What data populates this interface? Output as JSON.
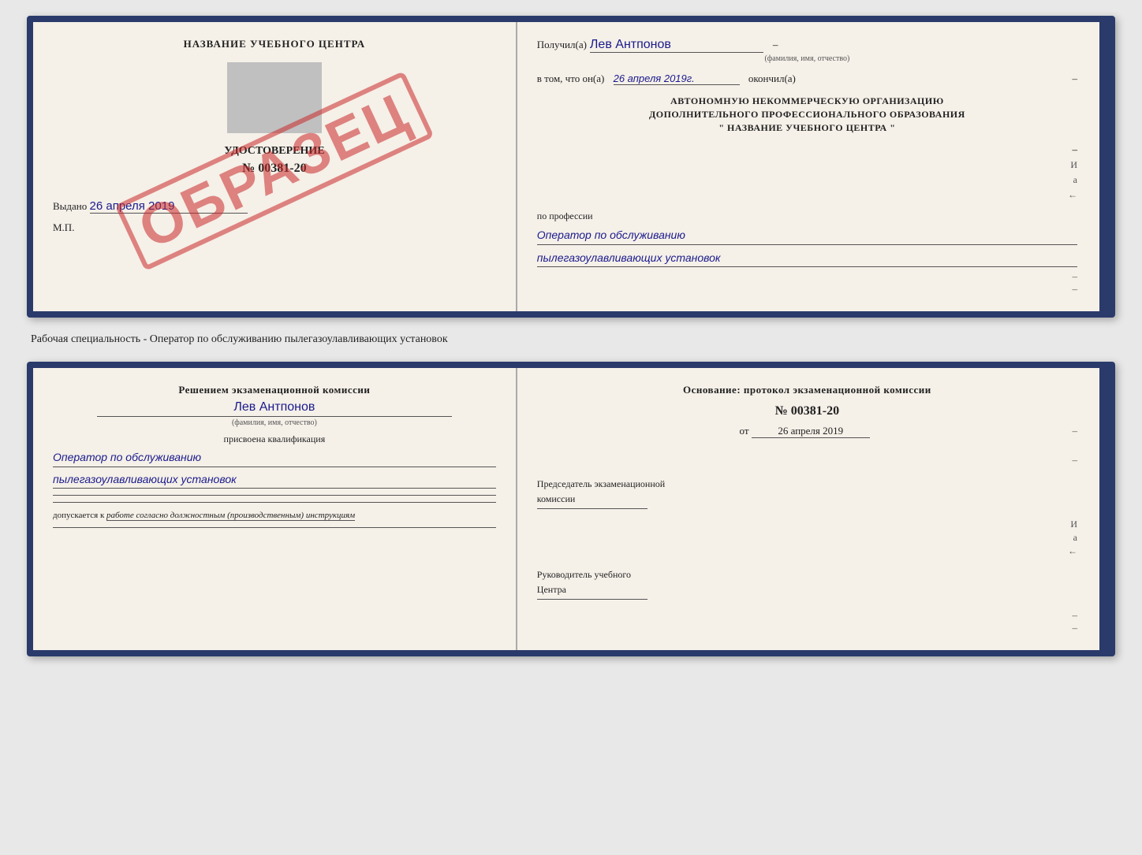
{
  "page": {
    "background": "#e8e8e8"
  },
  "topDoc": {
    "left": {
      "schoolNameLabel": "НАЗВАНИЕ УЧЕБНОГО ЦЕНТРА",
      "certTitle": "УДОСТОВЕРЕНИЕ",
      "certNumber": "№ 00381-20",
      "issuedText": "Выдано",
      "issuedDate": "26 апреля 2019",
      "mpLabel": "М.П.",
      "stampText": "ОБРАЗЕЦ"
    },
    "right": {
      "receivedLabel": "Получил(а)",
      "personName": "Лев Антпонов",
      "fioCaption": "(фамилия, имя, отчество)",
      "inThatText": "в том, что он(а)",
      "completedDate": "26 апреля 2019г.",
      "completedLabel": "окончил(а)",
      "orgLine1": "АВТОНОМНУЮ НЕКОММЕРЧЕСКУЮ ОРГАНИЗАЦИЮ",
      "orgLine2": "ДОПОЛНИТЕЛЬНОГО ПРОФЕССИОНАЛЬНОГО ОБРАЗОВАНИЯ",
      "orgLine3": "\"    НАЗВАНИЕ УЧЕБНОГО ЦЕНТРА    \"",
      "professionLabel": "по профессии",
      "professionLine1": "Оператор по обслуживанию",
      "professionLine2": "пылегазоулавливающих установок"
    }
  },
  "middleText": "Рабочая специальность - Оператор по обслуживанию пылегазоулавливающих установок",
  "bottomDoc": {
    "left": {
      "decisionText": "Решением экзаменационной комиссии",
      "personName": "Лев Антпонов",
      "fioCaption": "(фамилия, имя, отчество)",
      "qualLabel": "присвоена квалификация",
      "qualLine1": "Оператор по обслуживанию",
      "qualLine2": "пылегазоулавливающих установок",
      "допускаетсяLabel": "допускается к",
      "допускаетсяValue": "работе согласно должностным (производственным) инструкциям"
    },
    "right": {
      "osnovaniyeText": "Основание: протокол экзаменационной комиссии",
      "protocolNumber": "№  00381-20",
      "fromText": "от",
      "fromDate": "26 апреля 2019",
      "chairmanLabel1": "Председатель экзаменационной",
      "chairmanLabel2": "комиссии",
      "headLabel1": "Руководитель учебного",
      "headLabel2": "Центра"
    }
  },
  "sideChars": [
    "И",
    "а",
    "←",
    "–",
    "–",
    "–",
    "–",
    "–"
  ]
}
